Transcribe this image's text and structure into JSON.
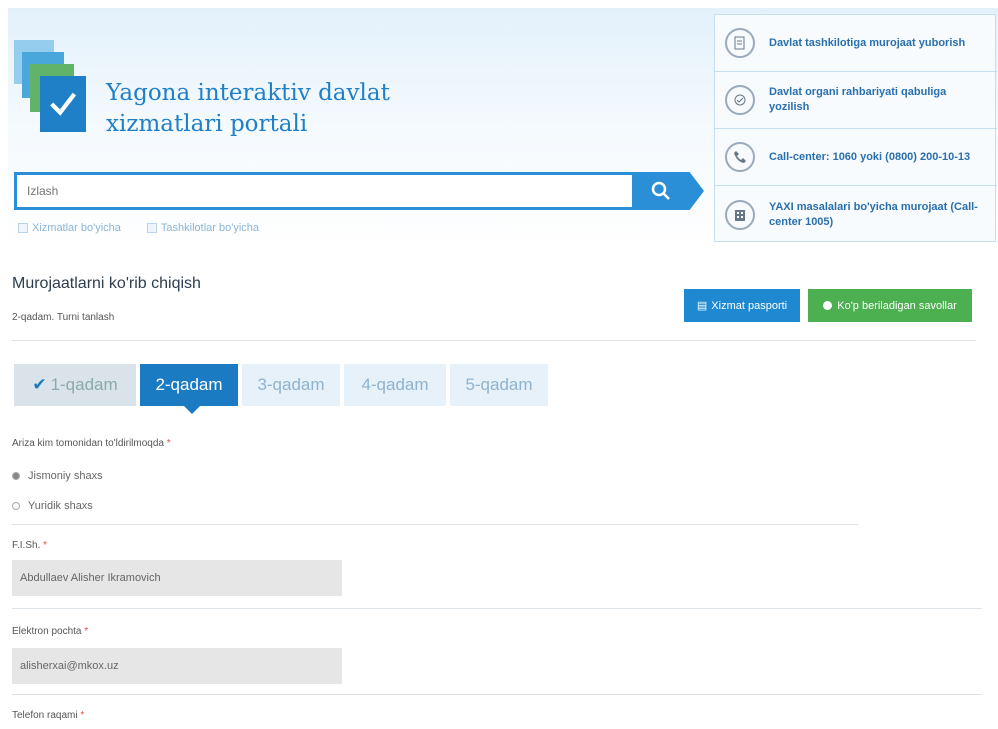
{
  "header": {
    "title": "Yagona interaktiv davlat xizmatlari portali",
    "search": {
      "placeholder": "Izlash",
      "button_icon": "search-icon"
    },
    "search_options": [
      "Xizmatlar bo'yicha",
      "Tashkilotlar bo'yicha"
    ]
  },
  "info_links": [
    {
      "icon": "document-edit-icon",
      "text": "Davlat tashkilotiga murojaat yuborish"
    },
    {
      "icon": "checkmark-circle-icon",
      "text": "Davlat organi rahbariyati qabuliga yozilish"
    },
    {
      "icon": "phone-icon",
      "text": "Call-center: 1060 yoki (0800) 200-10-13"
    },
    {
      "icon": "office-icon",
      "text": "YAXI masalalari bo'yicha murojaat (Call-center 1005)"
    }
  ],
  "page": {
    "title": "Murojaatlarni ko'rib chiqish",
    "subtitle": "2-qadam. Turni tanlash",
    "buttons": {
      "manual": "Xizmat pasporti",
      "help": "Ko'p beriladigan savollar"
    }
  },
  "steps": [
    {
      "label": "1-qadam",
      "state": "done"
    },
    {
      "label": "2-qadam",
      "state": "active"
    },
    {
      "label": "3-qadam",
      "state": "pending"
    },
    {
      "label": "4-qadam",
      "state": "pending"
    },
    {
      "label": "5-qadam",
      "state": "pending"
    }
  ],
  "form": {
    "applicant_label": "Arizа kim tomonidan to'ldirilmoqda",
    "applicant_options": [
      {
        "label": "Jismoniy shaxs",
        "selected": true
      },
      {
        "label": "Yuridik shaxs",
        "selected": false
      }
    ],
    "fio_label": "F.I.Sh.",
    "fio_value": "Abdullaev Alisher Ikramovich",
    "email_label": "Elektron pochta",
    "email_value": "alisherxai@mkox.uz",
    "phone_label": "Telefon raqami"
  },
  "colors": {
    "accent": "#1a7bc2",
    "green": "#4caf50"
  }
}
